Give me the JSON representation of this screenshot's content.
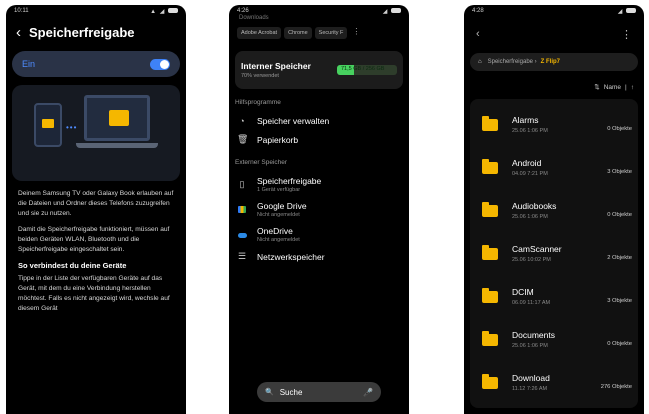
{
  "phone1": {
    "status_time": "10:11",
    "title": "Speicherfreigabe",
    "toggle_label": "Ein",
    "para1": "Deinem Samsung TV oder Galaxy Book erlauben auf die Dateien und Ordner dieses Telefons zuzugreifen und sie zu nutzen.",
    "para2": "Damit die Speicherfreigabe funktioniert, müssen auf beiden Geräten WLAN, Bluetooth und die Speicherfreigabe eingeschaltet sein.",
    "heading": "So verbindest du deine Geräte",
    "para3": "Tippe in der Liste der verfügbaren Geräte auf das Gerät, mit dem du eine Verbindung herstellen möchtest. Falls es nicht angezeigt wird, wechsle auf diesem Gerät"
  },
  "phone2": {
    "status_time": "4:26",
    "cut_title": "Downloads",
    "chips": [
      "Adobe Acrobat",
      "Chrome",
      "Security F"
    ],
    "storage_title": "Interner Speicher",
    "storage_sub": "70% verwendet",
    "storage_value": "71,5 GB / 256 GB",
    "storage_used_fraction": 0.28,
    "section1": "Hilfsprogramme",
    "manage": "Speicher verwalten",
    "trash": "Papierkorb",
    "section2": "Externer Speicher",
    "share_title": "Speicherfreigabe",
    "share_sub": "1 Gerät verfügbar",
    "gdrive_title": "Google Drive",
    "gdrive_sub": "Nicht angemeldet",
    "onedrive_title": "OneDrive",
    "onedrive_sub": "Nicht angemeldet",
    "network": "Netzwerkspeicher",
    "search": "Suche"
  },
  "phone3": {
    "status_time": "4:28",
    "crumb_parent": "Speicherfreigabe",
    "crumb_current": "Z Flip7",
    "sort_label": "Name",
    "folders": [
      {
        "name": "Alarms",
        "date": "25.06 1:06 PM",
        "count": "0 Objekte"
      },
      {
        "name": "Android",
        "date": "04.09 7:21 PM",
        "count": "3 Objekte"
      },
      {
        "name": "Audiobooks",
        "date": "25.06 1:06 PM",
        "count": "0 Objekte"
      },
      {
        "name": "CamScanner",
        "date": "25.06 10:02 PM",
        "count": "2 Objekte"
      },
      {
        "name": "DCIM",
        "date": "06.09 11:17 AM",
        "count": "3 Objekte"
      },
      {
        "name": "Documents",
        "date": "25.06 1:06 PM",
        "count": "0 Objekte"
      },
      {
        "name": "Download",
        "date": "11.12 7:26 AM",
        "count": "276 Objekte"
      }
    ]
  }
}
